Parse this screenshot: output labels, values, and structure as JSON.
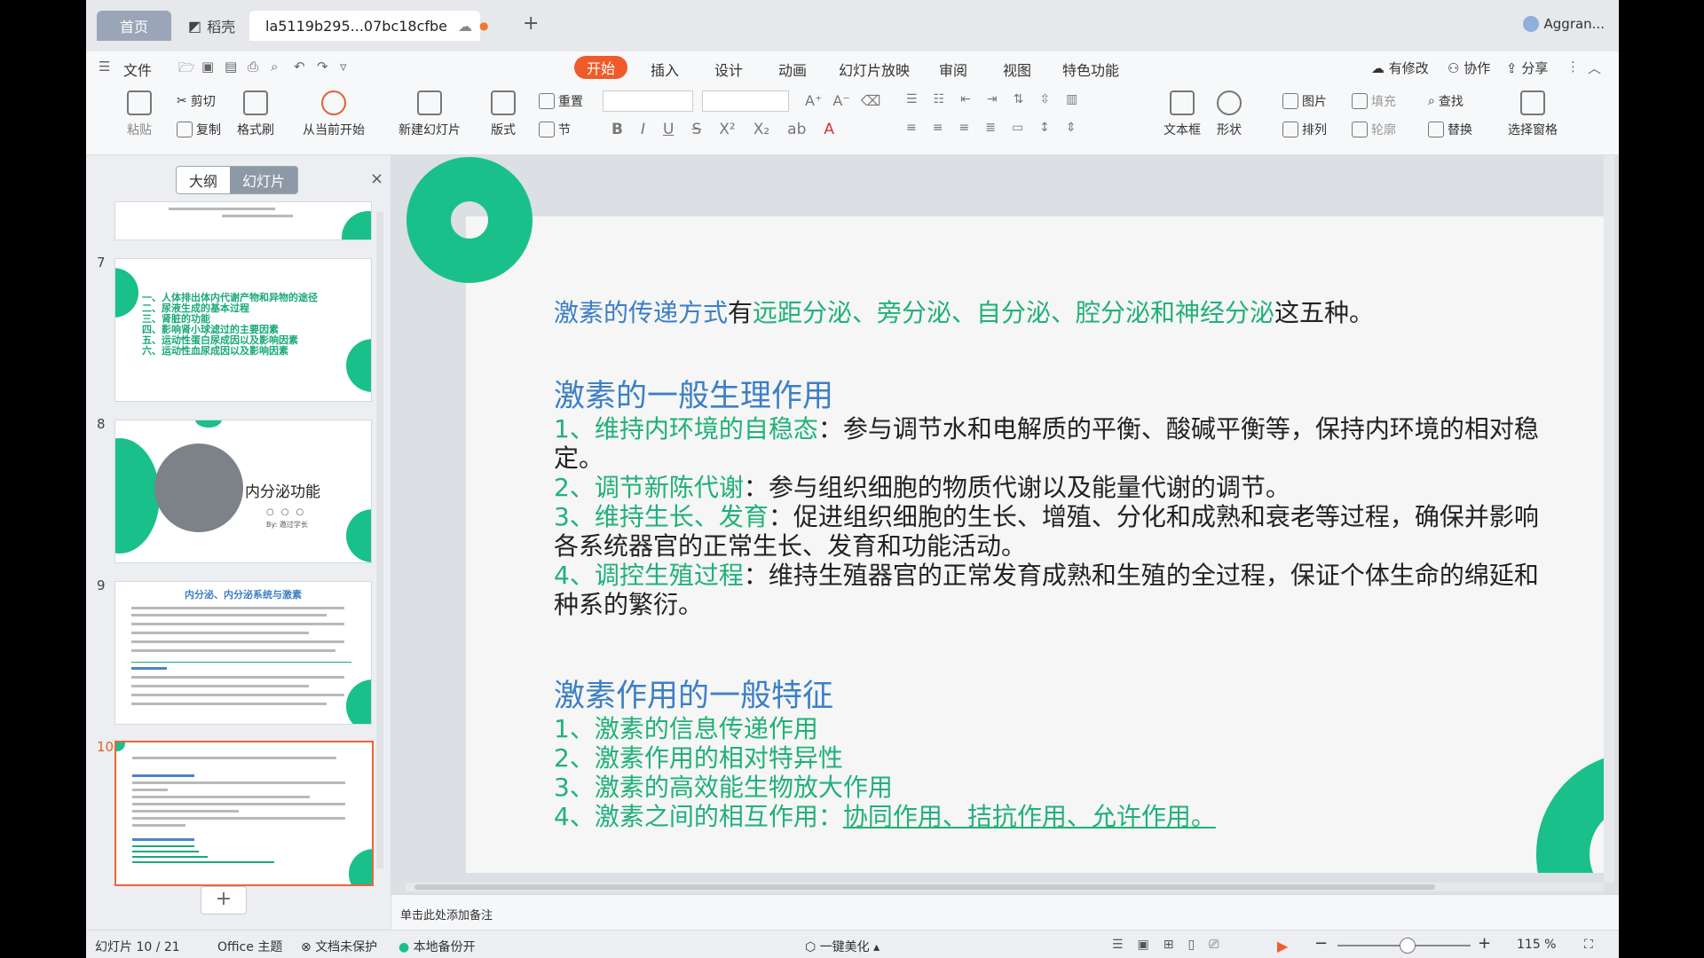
{
  "tabs": {
    "home": "首页",
    "docer": "稻壳",
    "doc_title": "la5119b295...07bc18cfbe",
    "new_tab": "+",
    "user": "Aggran..."
  },
  "menu": {
    "file": "文件",
    "items": [
      "开始",
      "插入",
      "设计",
      "动画",
      "幻灯片放映",
      "审阅",
      "视图",
      "特色功能"
    ],
    "right": [
      "有修改",
      "协作",
      "分享"
    ]
  },
  "ribbon": {
    "paste": "粘贴",
    "cut": "剪切",
    "copy": "复制",
    "format_painter": "格式刷",
    "from_current": "从当前开始",
    "new_slide": "新建幻灯片",
    "layout": "版式",
    "reset": "重置",
    "section": "节",
    "text_box": "文本框",
    "shape": "形状",
    "picture": "图片",
    "arrange": "排列",
    "fill": "填充",
    "outline": "轮廓",
    "find": "查找",
    "replace": "替换",
    "selection_pane": "选择窗格"
  },
  "panel": {
    "outline_tab": "大纲",
    "slides_tab": "幻灯片",
    "close": "×",
    "slide_numbers": [
      "7",
      "8",
      "9",
      "10"
    ],
    "thumb8_title": "内分泌功能",
    "thumb8_by": "By: 邀过学长",
    "thumb9_title": "内分泌、内分泌系统与激素",
    "thumb7_lines": [
      "一、人体排出体内代谢产物和异物的途径",
      "二、尿液生成的基本过程",
      "三、肾脏的功能",
      "四、影响肾小球滤过的主要因素",
      "五、运动性蛋白尿成因以及影响因素",
      "六、运动性血尿成因以及影响因素"
    ],
    "add": "+"
  },
  "slide": {
    "line1": {
      "a": "激素的传递方式",
      "b": "有",
      "c": "远距分泌、旁分泌、自分泌、腔分泌和神经分泌",
      "d": "这五种。"
    },
    "heading1": "激素的一般生理作用",
    "p1": {
      "num": "1、",
      "key": "维持内环境的自稳态",
      "text": "：参与调节水和电解质的平衡、酸碱平衡等，保持内环境的相对稳",
      "cont": "定。"
    },
    "p2": {
      "num": "2、",
      "key": "调节新陈代谢",
      "text": "：参与组织细胞的物质代谢以及能量代谢的调节。"
    },
    "p3": {
      "num": "3、",
      "key": "维持生长、发育",
      "text": "：促进组织细胞的生长、增殖、分化和成熟和衰老等过程，确保并影响",
      "cont": "各系统器官的正常生长、发育和功能活动。"
    },
    "p4": {
      "num": "4、",
      "key": "调控生殖过程",
      "text": "：维持生殖器官的正常发育成熟和生殖的全过程，保证个体生命的绵延和",
      "cont": "种系的繁衍。"
    },
    "heading2": "激素作用的一般特征",
    "f1": "1、激素的信息传递作用",
    "f2": "2、激素作用的相对特异性",
    "f3": "3、激素的高效能生物放大作用",
    "f4a": "4、激素之间的相互作用：",
    "f4b": "协同作用、拮抗作用、允许作用。"
  },
  "notes": "单击此处添加备注",
  "status": {
    "slide_count": "幻灯片 10 / 21",
    "theme": "Office 主题",
    "protect": "文档未保护",
    "backup": "本地备份开",
    "beautify": "一键美化",
    "zoom": "115 %"
  },
  "colors": {
    "accent": "#f05a2a",
    "green": "#19c08a",
    "blue": "#3d7fc6"
  }
}
